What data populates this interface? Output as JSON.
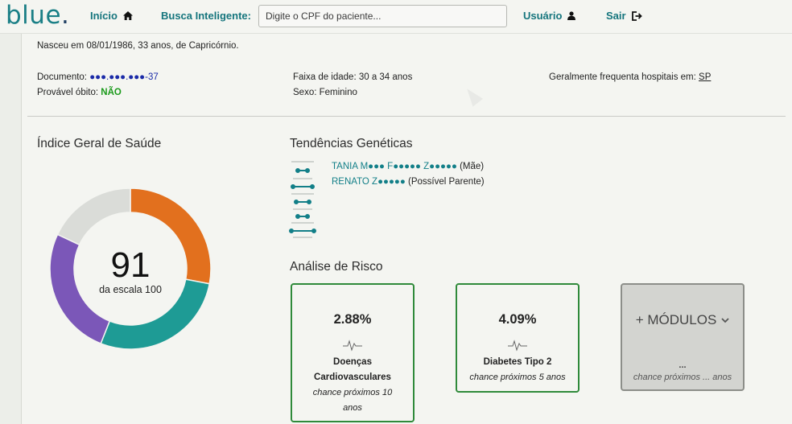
{
  "nav": {
    "logo_text": "blue",
    "logo_dot": ".",
    "home_label": "Início",
    "search_label": "Busca Inteligente:",
    "search_placeholder": "Digite o CPF do paciente...",
    "user_label": "Usuário",
    "logout_label": "Sair"
  },
  "patient": {
    "birth_line": "Nasceu em 08/01/1986, 33 anos, de Capricórnio.",
    "document_label": "Documento:",
    "document_value": "●●●.●●●.●●●-37",
    "death_label": "Provável óbito:",
    "death_value": "NÃO",
    "age_range": "Faixa de idade: 30 a 34 anos",
    "sex": "Sexo: Feminino",
    "hospital_label": "Geralmente frequenta hospitais em:",
    "hospital_state": "SP"
  },
  "health_index": {
    "title": "Índice Geral de Saúde",
    "score": "91",
    "score_caption": "da escala 100",
    "segments": [
      {
        "color": "#e2701e",
        "fraction": 0.28
      },
      {
        "color": "#1e9b95",
        "fraction": 0.28
      },
      {
        "color": "#7b57b8",
        "fraction": 0.26
      },
      {
        "color": "#dadcd8",
        "fraction": 0.18
      }
    ]
  },
  "genetics": {
    "title": "Tendências Genéticas",
    "relatives": [
      {
        "name": "TANIA M●●● F●●●●● Z●●●●●",
        "relation": "(Mãe)"
      },
      {
        "name": "RENATO Z●●●●●",
        "relation": "(Possível Parente)"
      }
    ]
  },
  "risk": {
    "title": "Análise de Risco",
    "cards": [
      {
        "percent": "2.88%",
        "name_line1": "Doenças",
        "name_line2": "Cardiovasculares",
        "chance_line1": "chance próximos 10",
        "chance_line2": "anos"
      },
      {
        "percent": "4.09%",
        "name_line1": "Diabetes Tipo 2",
        "chance_line1": "chance próximos 5 anos"
      }
    ],
    "more": {
      "label": "+ MÓDULOS",
      "dots": "...",
      "chance": "chance próximos ... anos"
    }
  },
  "colors": {
    "brand": "#1a7f86",
    "card_border": "#2f8a3a",
    "positive": "#1b9a1b"
  }
}
